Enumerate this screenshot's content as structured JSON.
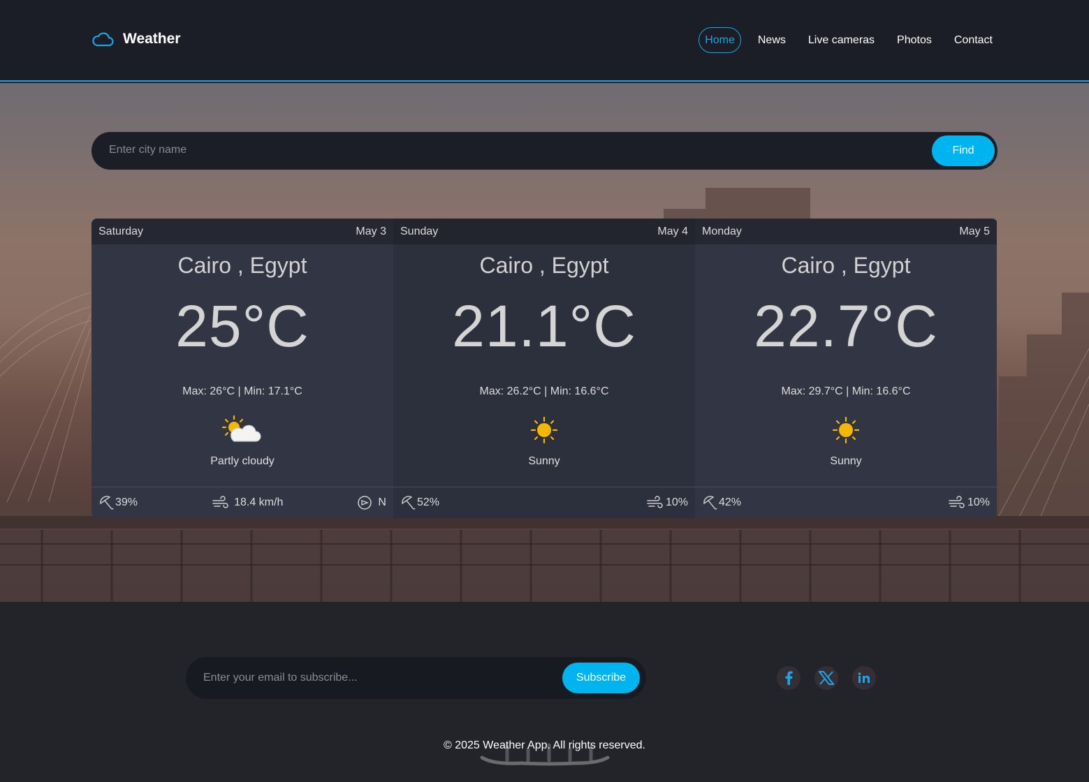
{
  "brand": {
    "name": "Weather",
    "icon": "cloud-icon"
  },
  "nav": [
    {
      "label": "Home",
      "active": true
    },
    {
      "label": "News",
      "active": false
    },
    {
      "label": "Live cameras",
      "active": false
    },
    {
      "label": "Photos",
      "active": false
    },
    {
      "label": "Contact",
      "active": false
    }
  ],
  "search": {
    "placeholder": "Enter city name",
    "button": "Find"
  },
  "forecast": [
    {
      "day": "Saturday",
      "date": "May 3",
      "location": "Cairo , Egypt",
      "temp": "25°C",
      "range": "Max: 26°C | Min: 17.1°C",
      "icon": "partly-cloudy-icon",
      "condition": "Partly cloudy",
      "rain": "39%",
      "wind": "18.4 km/h",
      "direction": "N"
    },
    {
      "day": "Sunday",
      "date": "May 4",
      "location": "Cairo , Egypt",
      "temp": "21.1°C",
      "range": "Max: 26.2°C | Min: 16.6°C",
      "icon": "sun-icon",
      "condition": "Sunny",
      "rain": "52%",
      "wind_pct": "10%"
    },
    {
      "day": "Monday",
      "date": "May 5",
      "location": "Cairo , Egypt",
      "temp": "22.7°C",
      "range": "Max: 29.7°C | Min: 16.6°C",
      "icon": "sun-icon",
      "condition": "Sunny",
      "rain": "42%",
      "wind_pct": "10%"
    }
  ],
  "footer": {
    "email_placeholder": "Enter your email to subscribe...",
    "subscribe_button": "Subscribe",
    "socials": [
      "facebook-icon",
      "x-twitter-icon",
      "linkedin-icon"
    ],
    "copyright": "© 2025 Weather App. All rights reserved."
  },
  "colors": {
    "accent": "#00b4f0",
    "header_bg": "#1c1e27",
    "card_bg": "#323644",
    "footer_bg": "#22242a"
  }
}
